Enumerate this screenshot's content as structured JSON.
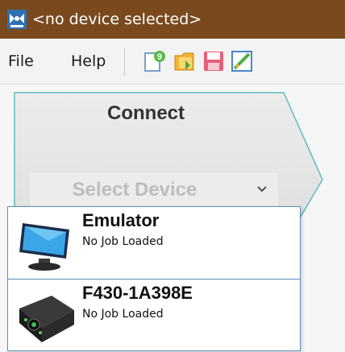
{
  "window": {
    "title": "<no device selected>",
    "app_icon": "app-logo-icon"
  },
  "menu": {
    "items": [
      {
        "label": "File"
      },
      {
        "label": "Help"
      }
    ]
  },
  "toolbar": {
    "icons": [
      "new-job-icon",
      "open-job-icon",
      "save-job-icon",
      "edit-job-icon"
    ]
  },
  "connect_panel": {
    "title": "Connect",
    "select_placeholder": "Select Device",
    "chevron_icon": "chevron-down-icon"
  },
  "devices": [
    {
      "name": "Emulator",
      "status": "No Job Loaded",
      "icon": "emulator-monitor-icon"
    },
    {
      "name": "F430-1A398E",
      "status": "No Job Loaded",
      "icon": "camera-device-icon"
    }
  ],
  "colors": {
    "titlebar": "#7a4a1e",
    "panel_border": "#5bbcc4",
    "dropdown_border": "#5a8fb8"
  }
}
